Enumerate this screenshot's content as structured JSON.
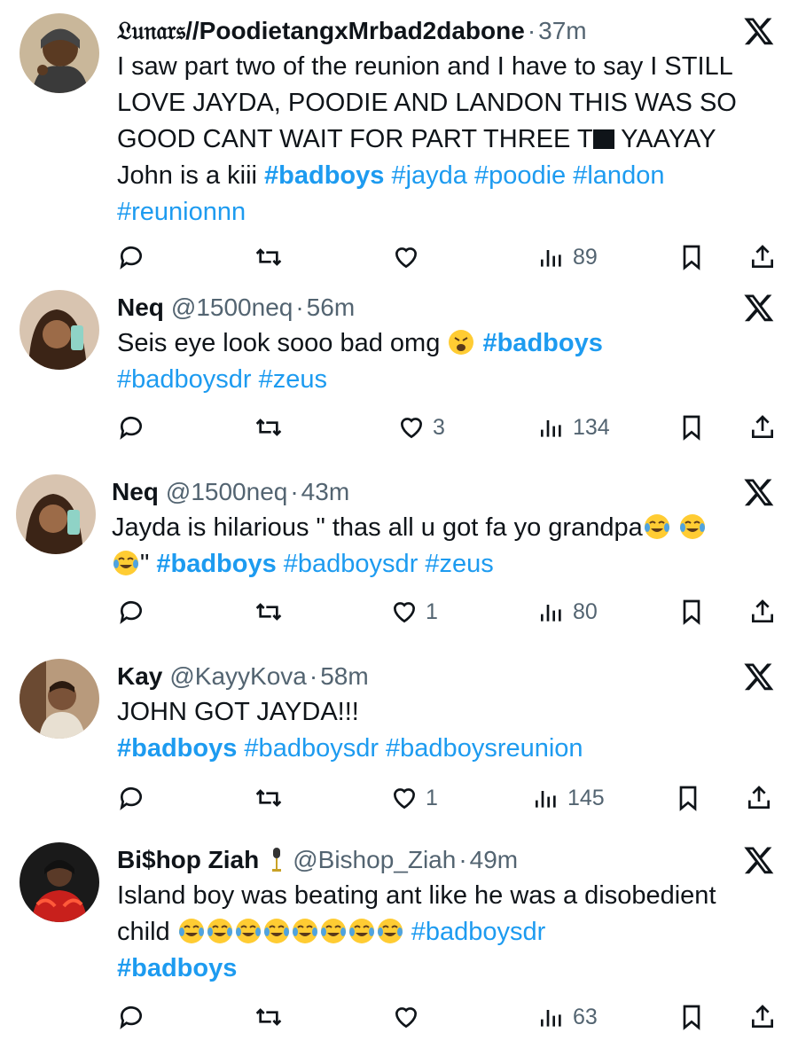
{
  "colors": {
    "text": "#0f1419",
    "secondary": "#536471",
    "link": "#1d9bf0"
  },
  "tweets": [
    {
      "name": "𝔏𝔲𝔫𝔞𝔯𝔰//PoodietangxMrbad2dabone",
      "handle": "",
      "time": "37m",
      "lines": [
        "I saw part two of the reunion and I have to say I STILL",
        "LOVE JAYDA, POODIE AND LANDON THIS WAS SO",
        "GOOD CANT WAIT FOR PART THREE T",
        " YAAYAY",
        "John is a kiii ",
        "#badboys",
        "#jayda #poodie #landon",
        "#reunionnn"
      ],
      "replies": "",
      "reposts": "",
      "likes": "",
      "views": "89"
    },
    {
      "name": "Neq",
      "handle": "@1500neq",
      "time": "56m",
      "lines": [
        "Seis eye look sooo bad omg",
        "#badboys",
        "#badboysdr #zeus"
      ],
      "replies": "",
      "reposts": "",
      "likes": "3",
      "views": "134"
    },
    {
      "name": "Neq",
      "handle": "@1500neq",
      "time": "43m",
      "lines": [
        "Jayda is hilarious \" thas all u got fa yo grandpa",
        "\" ",
        "#badboys",
        " #badboysdr #zeus"
      ],
      "replies": "",
      "reposts": "",
      "likes": "1",
      "views": "80"
    },
    {
      "name": "Kay",
      "handle": "@KayyKova",
      "time": "58m",
      "lines": [
        "JOHN GOT JAYDA!!!",
        "#badboys",
        " #badboysdr #badboysreunion"
      ],
      "replies": "",
      "reposts": "",
      "likes": "1",
      "views": "145"
    },
    {
      "name": "Bi$hop Ziah",
      "handle": "@Bishop_Ziah",
      "time": "49m",
      "lines": [
        "Island boy was beating ant like he was a disobedient",
        "child ",
        " #badboysdr",
        "#badboys"
      ],
      "replies": "",
      "reposts": "",
      "likes": "",
      "views": "63"
    }
  ]
}
